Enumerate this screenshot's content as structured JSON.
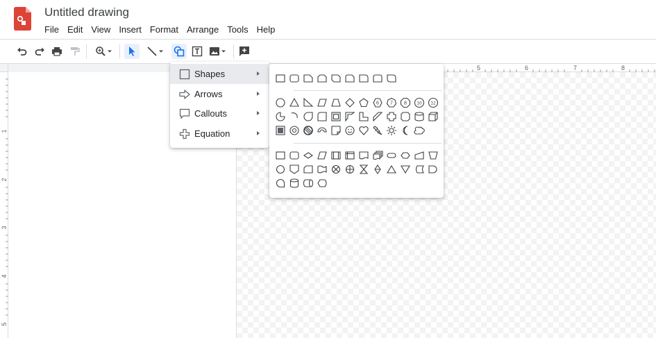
{
  "document": {
    "title": "Untitled drawing"
  },
  "menubar": [
    "File",
    "Edit",
    "View",
    "Insert",
    "Format",
    "Arrange",
    "Tools",
    "Help"
  ],
  "toolbar": {
    "icons": [
      "undo-icon",
      "redo-icon",
      "print-icon",
      "paint-format-icon",
      "zoom-icon",
      "select-icon",
      "line-icon",
      "shape-icon",
      "text-box-icon",
      "image-icon",
      "comment-add-icon"
    ],
    "active": "shape-icon",
    "accent": "#1a73e8"
  },
  "ruler": {
    "horizontal": [
      "5",
      "6",
      "7",
      "8"
    ],
    "vertical": [
      "1",
      "2",
      "3",
      "4",
      "5"
    ]
  },
  "shape_menu": {
    "items": [
      {
        "label": "Shapes",
        "icon": "square-icon"
      },
      {
        "label": "Arrows",
        "icon": "arrow-right-icon"
      },
      {
        "label": "Callouts",
        "icon": "callout-icon"
      },
      {
        "label": "Equation",
        "icon": "plus-icon"
      }
    ],
    "selected": "Shapes"
  },
  "shapes_palette": {
    "row1": [
      "rectangle",
      "rounded-rectangle",
      "snip-single-corner",
      "snip-same-side",
      "snip-diagonal",
      "snip-round",
      "round-single-corner",
      "round-same-side",
      "round-diagonal"
    ],
    "row2_labels": [
      "6",
      "7",
      "8",
      "10",
      "12"
    ]
  }
}
